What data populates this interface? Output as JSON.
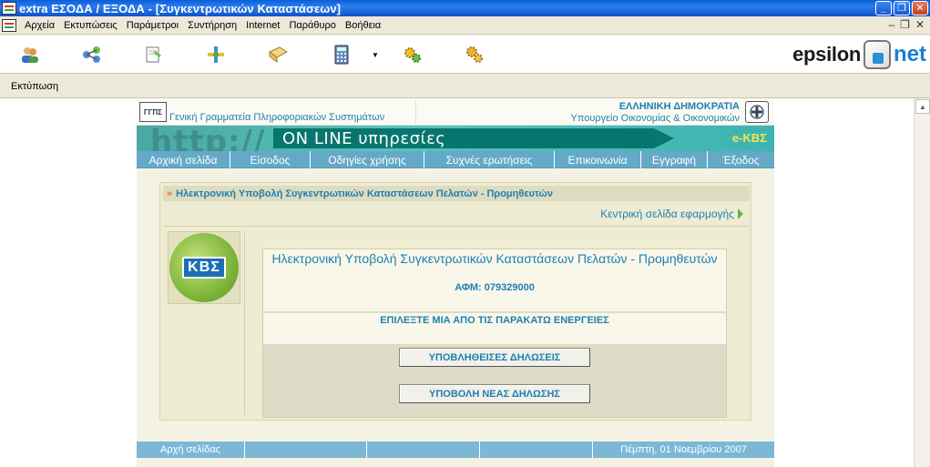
{
  "window": {
    "title": "extra ΕΣΟΔΑ / ΕΞΟΔΑ - [Συγκεντρωτικών Καταστάσεων]",
    "minimize": "_",
    "maximize": "❐",
    "close": "✕"
  },
  "menu": {
    "items": [
      "Αρχεία",
      "Εκτυπώσεις",
      "Παράμετροι",
      "Συντήρηση",
      "Internet",
      "Παράθυρο",
      "Βοήθεια"
    ],
    "mdi_minimize": "–",
    "mdi_restore": "❐",
    "mdi_close": "✕"
  },
  "toolbar": {
    "dropdown_arrow": "▼",
    "brand_word": "epsilon",
    "brand_net": "net"
  },
  "subbar": {
    "print_label": "Εκτύπωση"
  },
  "site": {
    "header": {
      "logo_text": "ΓΓΠΣ",
      "org": "Γενική Γραμματεία Πληροφοριακών Συστημάτων",
      "gov_line1": "ΕΛΛΗΝΙΚΗ ΔΗΜΟΚΡΑΤΙΑ",
      "gov_line2": "Υπουργείο Οικονομίας & Οικονομικών"
    },
    "banner": {
      "http": "http://",
      "online": "ΟΝ LINE υπηρεσίες",
      "ekvs": "e-ΚΒΣ"
    },
    "nav": [
      "Αρχική σελίδα",
      "Είσοδος",
      "Οδηγίες χρήσης",
      "Συχνές ερωτήσεις",
      "Επικοινωνία",
      "Εγγραφή",
      "Έξοδος"
    ],
    "panel": {
      "title": "Ηλεκτρονική Υποβολή Συγκεντρωτικών Καταστάσεων Πελατών - Προμηθευτών",
      "arrows": "»",
      "main_link": "Κεντρική σελίδα εφαρμογής",
      "kvs_logo": "ΚΒΣ",
      "inner_title": "Ηλεκτρονική Υποβολή Συγκεντρωτικών Καταστάσεων Πελατών - Προμηθευτών",
      "afm": "ΑΦΜ: 079329000",
      "choose": "ΕΠΙΛΕΞΤΕ ΜΙΑ ΑΠΟ ΤΙΣ ΠΑΡΑΚΑΤΩ ΕΝΕΡΓΕΙΕΣ",
      "btn_submitted": "ΥΠΟΒΛΗΘΕΙΣΕΣ ΔΗΛΩΣΕΙΣ",
      "btn_new": "ΥΠΟΒΟΛΗ ΝΕΑΣ ΔΗΛΩΣΗΣ"
    },
    "footer": {
      "home": "Αρχή σελίδας",
      "date": "Πέμπτη, 01 Νοεμβρίου 2007"
    }
  },
  "scrollbar": {
    "up_arrow": "▲"
  }
}
